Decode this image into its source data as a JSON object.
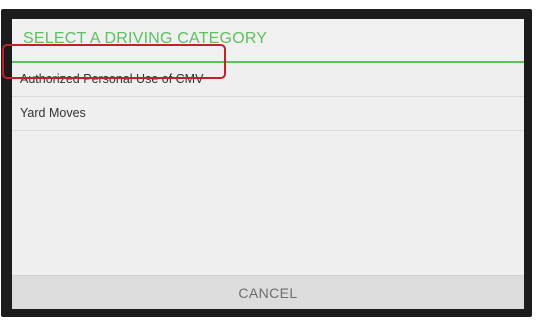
{
  "dialog": {
    "title": "SELECT A DRIVING CATEGORY",
    "options": [
      {
        "label": "Authorized Personal Use of CMV"
      },
      {
        "label": "Yard Moves"
      }
    ],
    "cancel_label": "CANCEL"
  },
  "colors": {
    "accent": "#5cc25c",
    "highlight": "#c4202b",
    "frame": "#1c1c1c",
    "dialog_background": "#efefef",
    "footer_background": "#dcdcdc"
  }
}
